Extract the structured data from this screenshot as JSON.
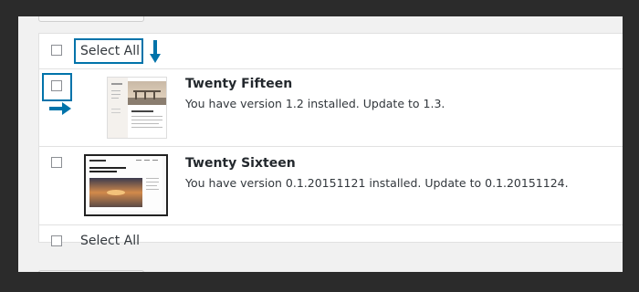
{
  "header": {
    "select_all_label": "Select All"
  },
  "footer": {
    "select_all_label": "Select All"
  },
  "themes": [
    {
      "name": "Twenty Fifteen",
      "status": "You have version 1.2 installed. Update to 1.3."
    },
    {
      "name": "Twenty Sixteen",
      "status": "You have version 0.1.20151121 installed. Update to 0.1.20151124."
    }
  ],
  "colors": {
    "highlight": "#0073aa",
    "background": "#2b2b2b",
    "panel": "#f1f1f1"
  }
}
